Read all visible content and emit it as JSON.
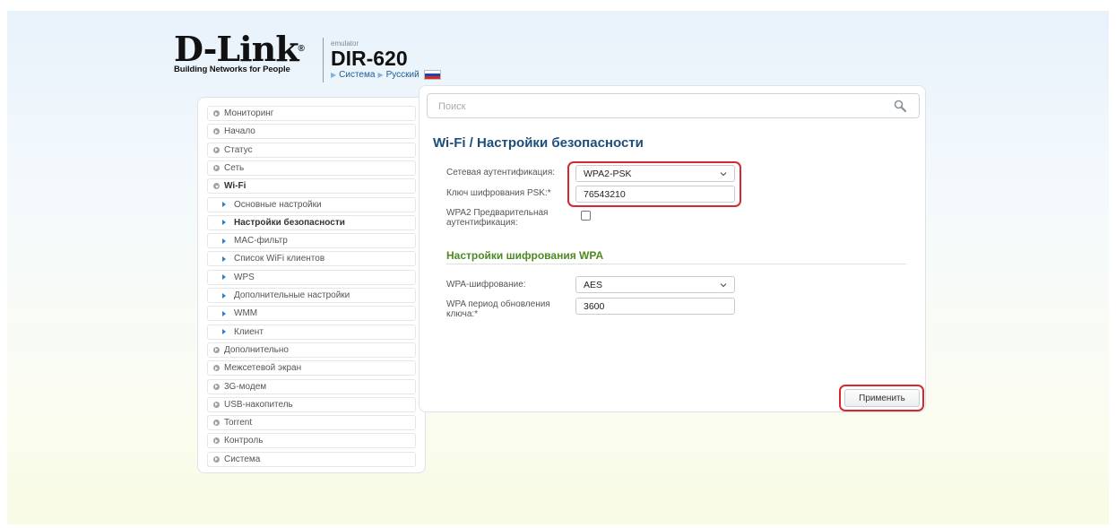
{
  "header": {
    "logo_word": "D-Link",
    "logo_reg": "®",
    "logo_tagline": "Building Networks for People",
    "emulator_label": "emulator",
    "model": "DIR-620",
    "breadcrumb_system": "Система",
    "breadcrumb_language": "Русский"
  },
  "sidebar": {
    "items": [
      {
        "label": "Мониторинг",
        "level": 0
      },
      {
        "label": "Начало",
        "level": 0
      },
      {
        "label": "Статус",
        "level": 0
      },
      {
        "label": "Сеть",
        "level": 0
      },
      {
        "label": "Wi-Fi",
        "level": 0,
        "expanded": true
      },
      {
        "label": "Основные настройки",
        "level": 1
      },
      {
        "label": "Настройки безопасности",
        "level": 1,
        "active": true
      },
      {
        "label": "MAC-фильтр",
        "level": 1
      },
      {
        "label": "Список WiFi клиентов",
        "level": 1
      },
      {
        "label": "WPS",
        "level": 1
      },
      {
        "label": "Дополнительные настройки",
        "level": 1
      },
      {
        "label": "WMM",
        "level": 1
      },
      {
        "label": "Клиент",
        "level": 1
      },
      {
        "label": "Дополнительно",
        "level": 0
      },
      {
        "label": "Межсетевой экран",
        "level": 0
      },
      {
        "label": "3G-модем",
        "level": 0
      },
      {
        "label": "USB-накопитель",
        "level": 0
      },
      {
        "label": "Torrent",
        "level": 0
      },
      {
        "label": "Контроль",
        "level": 0
      },
      {
        "label": "Система",
        "level": 0
      }
    ]
  },
  "search": {
    "placeholder": "Поиск",
    "value": ""
  },
  "main": {
    "title": "Wi-Fi /  Настройки безопасности",
    "auth_label": "Сетевая аутентификация:",
    "auth_value": "WPA2-PSK",
    "psk_label": "Ключ шифрования PSK:*",
    "psk_value": "76543210",
    "preauth_label": "WPA2 Предварительная аутентификация:",
    "preauth_checked": false,
    "wpa_section_title": "Настройки шифрования WPA",
    "wpa_enc_label": "WPA-шифрование:",
    "wpa_enc_value": "AES",
    "wpa_period_label": "WPA период обновления ключа:*",
    "wpa_period_value": "3600",
    "apply_label": "Применить"
  },
  "colors": {
    "title": "#1d4e7a",
    "section_title": "#4d8a1f",
    "highlight": "#d6282f",
    "link": "#1d5c96"
  },
  "icons": {
    "search": "search-icon",
    "dropdown": "chevron-down-icon"
  }
}
